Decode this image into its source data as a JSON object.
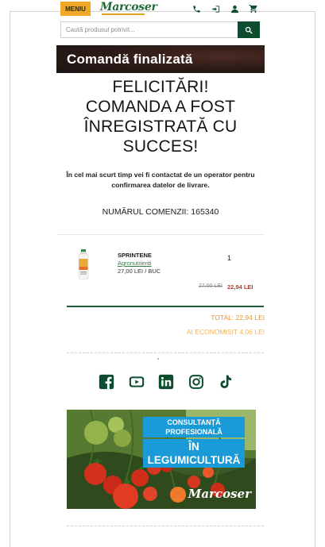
{
  "header": {
    "menu_label": "MENIU",
    "logo_text": "Marcoser",
    "icons": [
      "phone-icon",
      "login-icon",
      "user-icon",
      "cart-icon"
    ]
  },
  "search": {
    "placeholder": "Caută produsul potrivit..."
  },
  "banner": {
    "title": "Comandă finalizată"
  },
  "confirmation": {
    "heading_lines": [
      "FELICITĂRI!",
      "COMANDA A FOST",
      "ÎNREGISTRATĂ CU",
      "SUCCES!"
    ],
    "notice": "În cel mai scurt timp vei fi contactat de un operator pentru confirmarea datelor de livrare.",
    "order_number_text": "NUMĂRUL COMENZII: 165340"
  },
  "order": {
    "items": [
      {
        "name": "SPRINTENE",
        "category": "Agronutrienti",
        "unit_price": "27,00 LEI / BUC",
        "quantity": "1",
        "old_price": "27,00 LEI",
        "new_price": "22,94 LEI"
      }
    ],
    "total": "TOTAL: 22,94 LEI",
    "saved": "AI ECONOMISIT 4,06 LEI"
  },
  "social": [
    "facebook-icon",
    "youtube-icon",
    "linkedin-icon",
    "instagram-icon",
    "tiktok-icon"
  ],
  "promo": {
    "line1": "CONSULTANȚĂ PROFESIONALĂ",
    "line2": "ÎN LEGUMICULTURĂ",
    "brand": "Marcoser"
  },
  "colors": {
    "brand_green": "#0d4c2e",
    "menu_orange": "#f2a826",
    "discount_red": "#c0392b",
    "total_orange": "#e8932b",
    "promo_blue": "#1a9ad6"
  }
}
